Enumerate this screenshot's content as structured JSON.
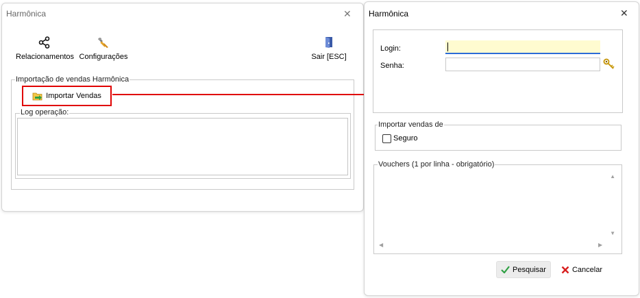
{
  "main_window": {
    "title": "Harmônica",
    "toolbar": {
      "relacionamentos": "Relacionamentos",
      "configuracoes": "Configurações",
      "sair": "Sair [ESC]"
    },
    "import_group_legend": "Importação de vendas Harmônica",
    "import_button_label": "Importar Vendas",
    "log_group_legend": "Log operação:"
  },
  "dialog": {
    "title": "Harmônica",
    "login_label": "Login:",
    "login_value": "",
    "senha_label": "Senha:",
    "senha_value": "",
    "importar_de_legend": "Importar vendas de",
    "seguro_label": "Seguro",
    "seguro_checked": false,
    "vouchers_legend": "Vouchers (1 por linha - obrigatório)",
    "vouchers_value": "",
    "pesquisar_label": "Pesquisar",
    "cancelar_label": "Cancelar"
  },
  "colors": {
    "highlight": "#e00000",
    "login_bg": "#fffbd0",
    "focus_underline": "#2b6cd6"
  },
  "icons": {
    "relacionamentos": "share-nodes-icon",
    "configuracoes": "wrench-icon",
    "sair": "exit-door-icon",
    "importar": "folder-import-icon",
    "senha": "keys-icon",
    "pesquisar": "checkmark-icon",
    "cancelar": "x-icon",
    "close": "close-icon"
  }
}
